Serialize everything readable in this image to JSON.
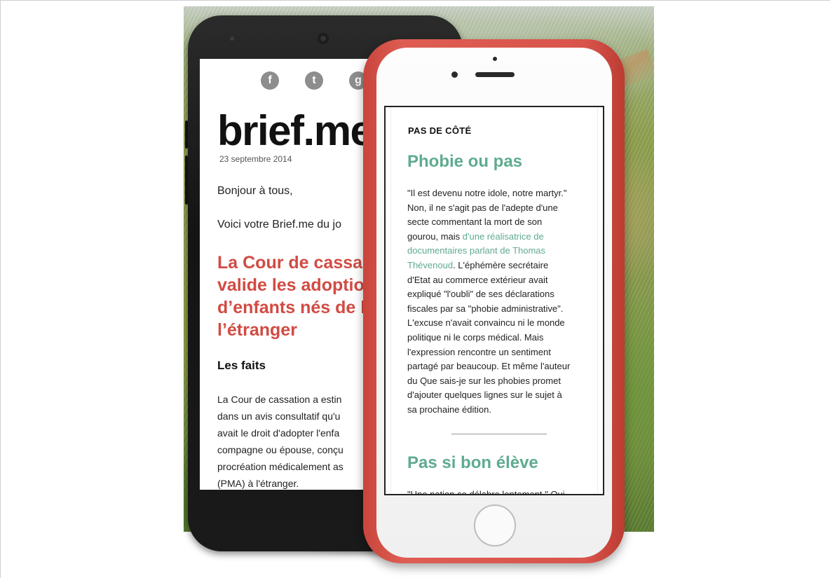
{
  "android": {
    "social_icons": [
      "facebook-icon",
      "twitter-icon",
      "googleplus-icon"
    ],
    "brand": "brief.me",
    "date": "23 septembre 2014",
    "greeting": "Bonjour à tous,",
    "intro": "Voici votre Brief.me du jo",
    "headline": [
      "La Cour de cassa",
      "valide les adoptio",
      "d’enfants nés de l",
      "l’étranger"
    ],
    "section_title": "Les faits",
    "body": [
      "La Cour de cassation a estin",
      "dans un avis consultatif qu'u",
      "avait le droit d'adopter l'enfa",
      "compagne ou épouse, conçu",
      "procréation médicalement as",
      "(PMA) à l'étranger."
    ]
  },
  "iphone": {
    "kicker": "PAS DE CÔTÉ",
    "title": "Phobie ou pas",
    "body_lines": [
      "\"Il est devenu notre idole, notre martyr.\"",
      "Non, il ne s'agit pas de l'adepte d'une",
      "secte commentant la mort de son",
      "gourou, mais "
    ],
    "link_lines": [
      "d'une réalisatrice de",
      "documentaires parlant de Thomas",
      "Thévenoud"
    ],
    "after_link": ". L'éphémère secrétaire",
    "body_lines2": [
      "d'Etat au commerce extérieur avait",
      "expliqué \"l'oubli\" de ses déclarations",
      "fiscales par sa \"phobie administrative\".",
      "L'excuse n'avait convaincu ni le monde",
      "politique ni le corps médical. Mais",
      "l'expression rencontre un sentiment",
      "partagé par beaucoup. Et même l'auteur",
      "du Que sais-je sur les phobies promet",
      "d'ajouter quelques lignes sur le sujet à",
      "sa prochaine édition."
    ],
    "title2": "Pas si bon élève",
    "cut_text": "\"Une nation se délabre lentement.\" Qui"
  }
}
